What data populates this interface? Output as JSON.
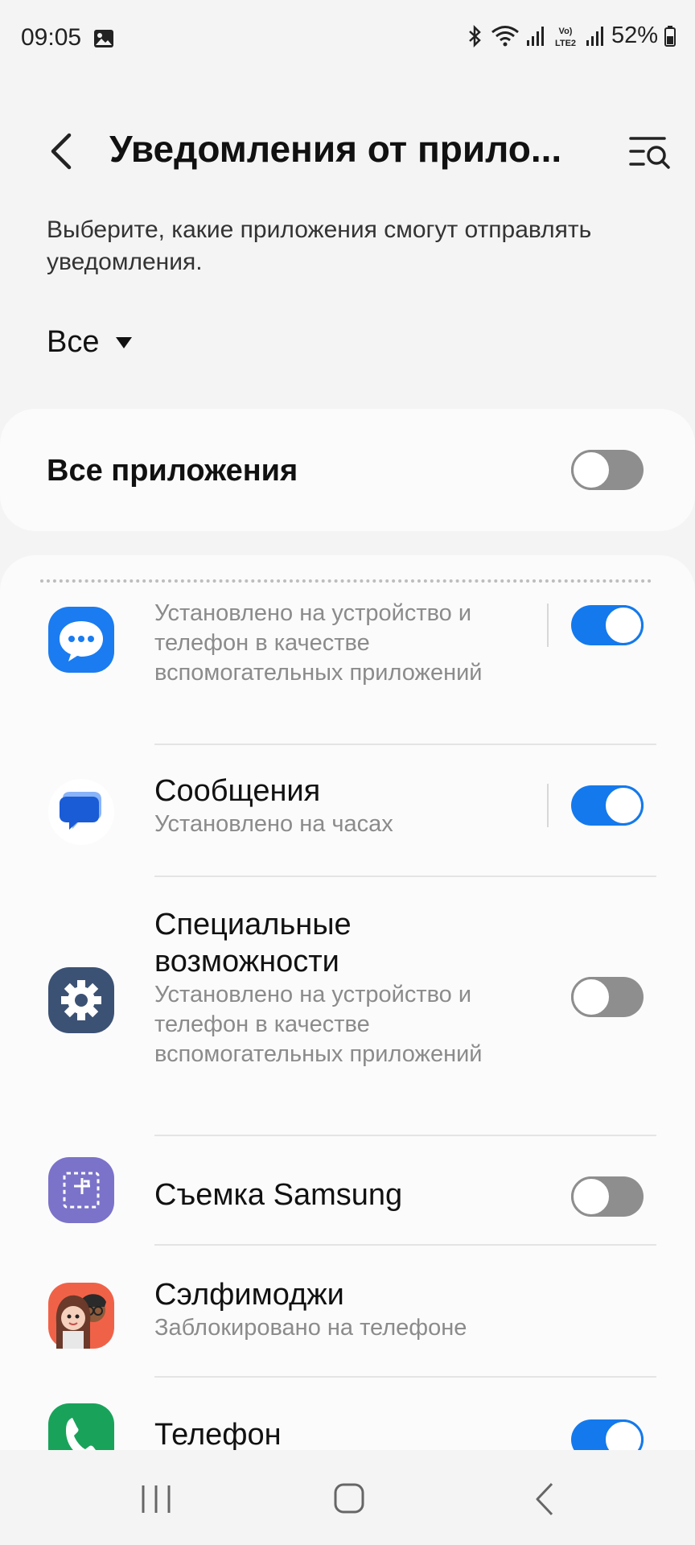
{
  "status_bar": {
    "time": "09:05",
    "battery": "52%",
    "icons": [
      "image-icon",
      "bluetooth-icon",
      "wifi-icon",
      "signal-icon",
      "volte-lte2-icon",
      "signal-icon",
      "battery-icon"
    ]
  },
  "header": {
    "title": "Уведомления от прило...",
    "back_icon": "chevron-left-icon",
    "search_icon": "list-search-icon"
  },
  "description": "Выберите, какие приложения смогут отправлять уведомления.",
  "filter": {
    "label": "Все",
    "icon": "dropdown-triangle-icon"
  },
  "all_apps": {
    "label": "Все приложения",
    "enabled": false
  },
  "apps": [
    {
      "name": "",
      "subtitle": "Установлено на устройство и телефон в качестве вспомогательных приложений",
      "icon": "samsung-messages-icon",
      "enabled": true
    },
    {
      "name": "Сообщения",
      "subtitle": "Установлено на часах",
      "icon": "google-messages-icon",
      "enabled": true
    },
    {
      "name": "Специальные возможности",
      "subtitle": "Установлено на устройство и телефон в качестве вспомогательных приложений",
      "icon": "accessibility-gear-icon",
      "enabled": false
    },
    {
      "name": "Съемка Samsung",
      "subtitle": "",
      "icon": "samsung-capture-icon",
      "enabled": false
    },
    {
      "name": "Сэлфимоджи",
      "subtitle": "Заблокировано на телефоне",
      "icon": "selfiemoji-icon",
      "enabled": null
    },
    {
      "name": "Телефон",
      "subtitle": "",
      "icon": "phone-icon",
      "enabled": true
    }
  ],
  "colors": {
    "accent": "#1479ec",
    "toggle_off": "#8e8e8e",
    "background": "#f4f4f4",
    "card": "#fbfbfb"
  },
  "nav_bar": {
    "icons": [
      "recent-apps-icon",
      "home-icon",
      "back-icon"
    ]
  }
}
